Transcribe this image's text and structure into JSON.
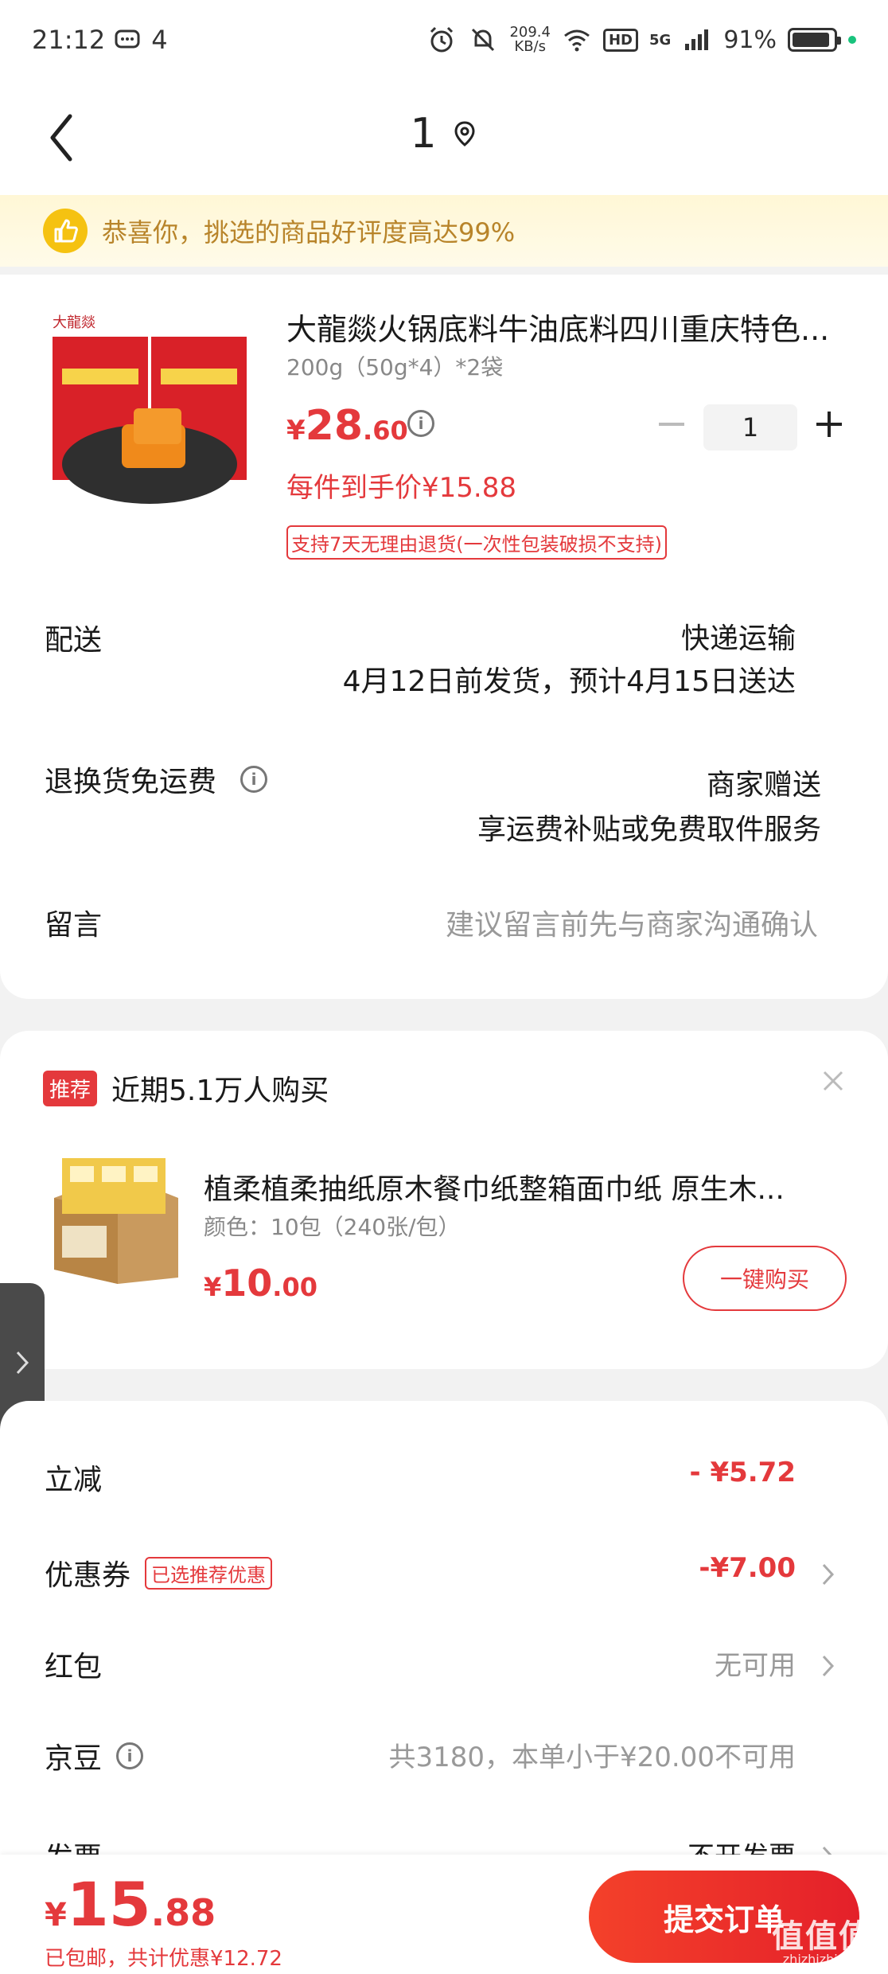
{
  "status_bar": {
    "time": "21:12",
    "msg_count": "4",
    "net_speed_value": "209.4",
    "net_speed_unit": "KB/s",
    "hd": "HD",
    "signal": "5G",
    "battery": "91%",
    "battery_level": 0.91
  },
  "header": {
    "title": "1"
  },
  "notice": {
    "text": "恭喜你，挑选的商品好评度高达99%"
  },
  "product": {
    "title": "大龍燚火锅底料牛油底料四川重庆特色...",
    "spec": "200g（50g*4）*2袋",
    "price_yen": "¥",
    "price_int": "28",
    "price_dec": ".60",
    "quantity": "1",
    "unit_price": "每件到手价¥15.88",
    "return_policy": "支持7天无理由退货(一次性包装破损不支持)"
  },
  "delivery": {
    "label": "配送",
    "method": "快递运输",
    "eta": "4月12日前发货，预计4月15日送达"
  },
  "return_shipping": {
    "label": "退换货免运费",
    "value1": "商家赠送",
    "value2": "享运费补贴或免费取件服务"
  },
  "message": {
    "label": "留言",
    "placeholder": "建议留言前先与商家沟通确认"
  },
  "recommendation": {
    "badge": "推荐",
    "title": "近期5.1万人购买",
    "product_name": "植柔植柔抽纸原木餐巾纸整箱面巾纸 原生木...",
    "spec": "颜色：10包（240张/包）",
    "price_yen": "¥",
    "price_int": "10",
    "price_dec": ".00",
    "buy_label": "一键购买"
  },
  "summary": {
    "discount_label": "立减",
    "discount_value": "- ¥5.72",
    "coupon_label": "优惠券",
    "coupon_tag": "已选推荐优惠",
    "coupon_value": "-¥7.00",
    "redpacket_label": "红包",
    "redpacket_value": "无可用",
    "jingdou_label": "京豆",
    "jingdou_value": "共3180，本单小于¥20.00不可用",
    "invoice_label": "发票",
    "invoice_value": "不开发票"
  },
  "bottom": {
    "price_yen": "¥",
    "price_int": "15",
    "price_dec": ".88",
    "sub": "已包邮，共计优惠¥12.72",
    "submit": "提交订单"
  },
  "watermark": {
    "text": "值值值",
    "site": "zhizhizhi.com"
  },
  "colors": {
    "accent": "#e4393c",
    "notice_text": "#b8842a",
    "notice_bg": "#fff7d6"
  }
}
